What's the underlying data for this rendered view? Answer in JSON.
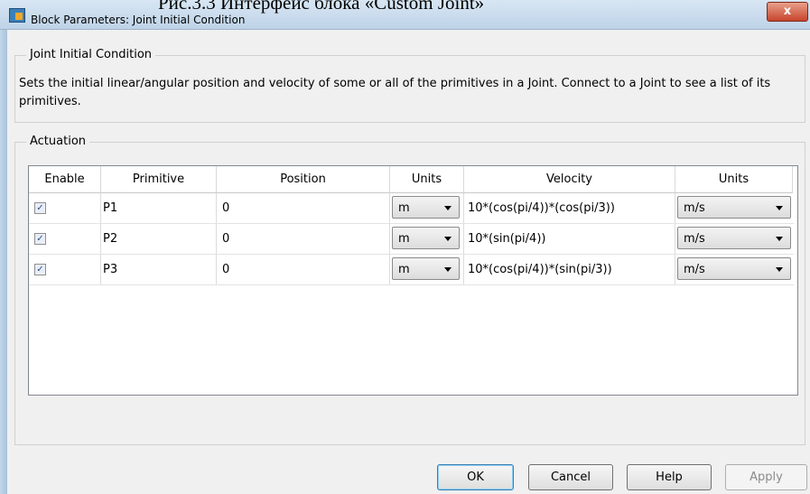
{
  "caption": "Рис.3.3 Интерфейс блока «Custom Joint»",
  "window": {
    "title": "Block Parameters: Joint Initial Condition",
    "close_glyph": "x"
  },
  "section": {
    "legend": "Joint Initial Condition",
    "description": "Sets the initial linear/angular position and velocity of some or all of the primitives in a Joint. Connect to a Joint to see a list of its primitives."
  },
  "actuation": {
    "legend": "Actuation",
    "columns": [
      "Enable",
      "Primitive",
      "Position",
      "Units",
      "Velocity",
      "Units"
    ],
    "rows": [
      {
        "enabled": true,
        "primitive": "P1",
        "position": "0",
        "pos_units": "m",
        "velocity": "10*(cos(pi/4))*(cos(pi/3))",
        "vel_units": "m/s"
      },
      {
        "enabled": true,
        "primitive": "P2",
        "position": "0",
        "pos_units": "m",
        "velocity": "10*(sin(pi/4))",
        "vel_units": "m/s"
      },
      {
        "enabled": true,
        "primitive": "P3",
        "position": "0",
        "pos_units": "m",
        "velocity": "10*(cos(pi/4))*(sin(pi/3))",
        "vel_units": "m/s"
      }
    ]
  },
  "buttons": {
    "ok": "OK",
    "cancel": "Cancel",
    "help": "Help",
    "apply": "Apply"
  },
  "colors": {
    "titlebar": "#c8dbed",
    "close": "#c7442d",
    "dialog_bg": "#f0f0f0"
  },
  "icons": {
    "app": "block-parameters-icon",
    "close": "close-icon",
    "check": "checkmark-icon",
    "dropdown": "chevron-down-icon"
  }
}
